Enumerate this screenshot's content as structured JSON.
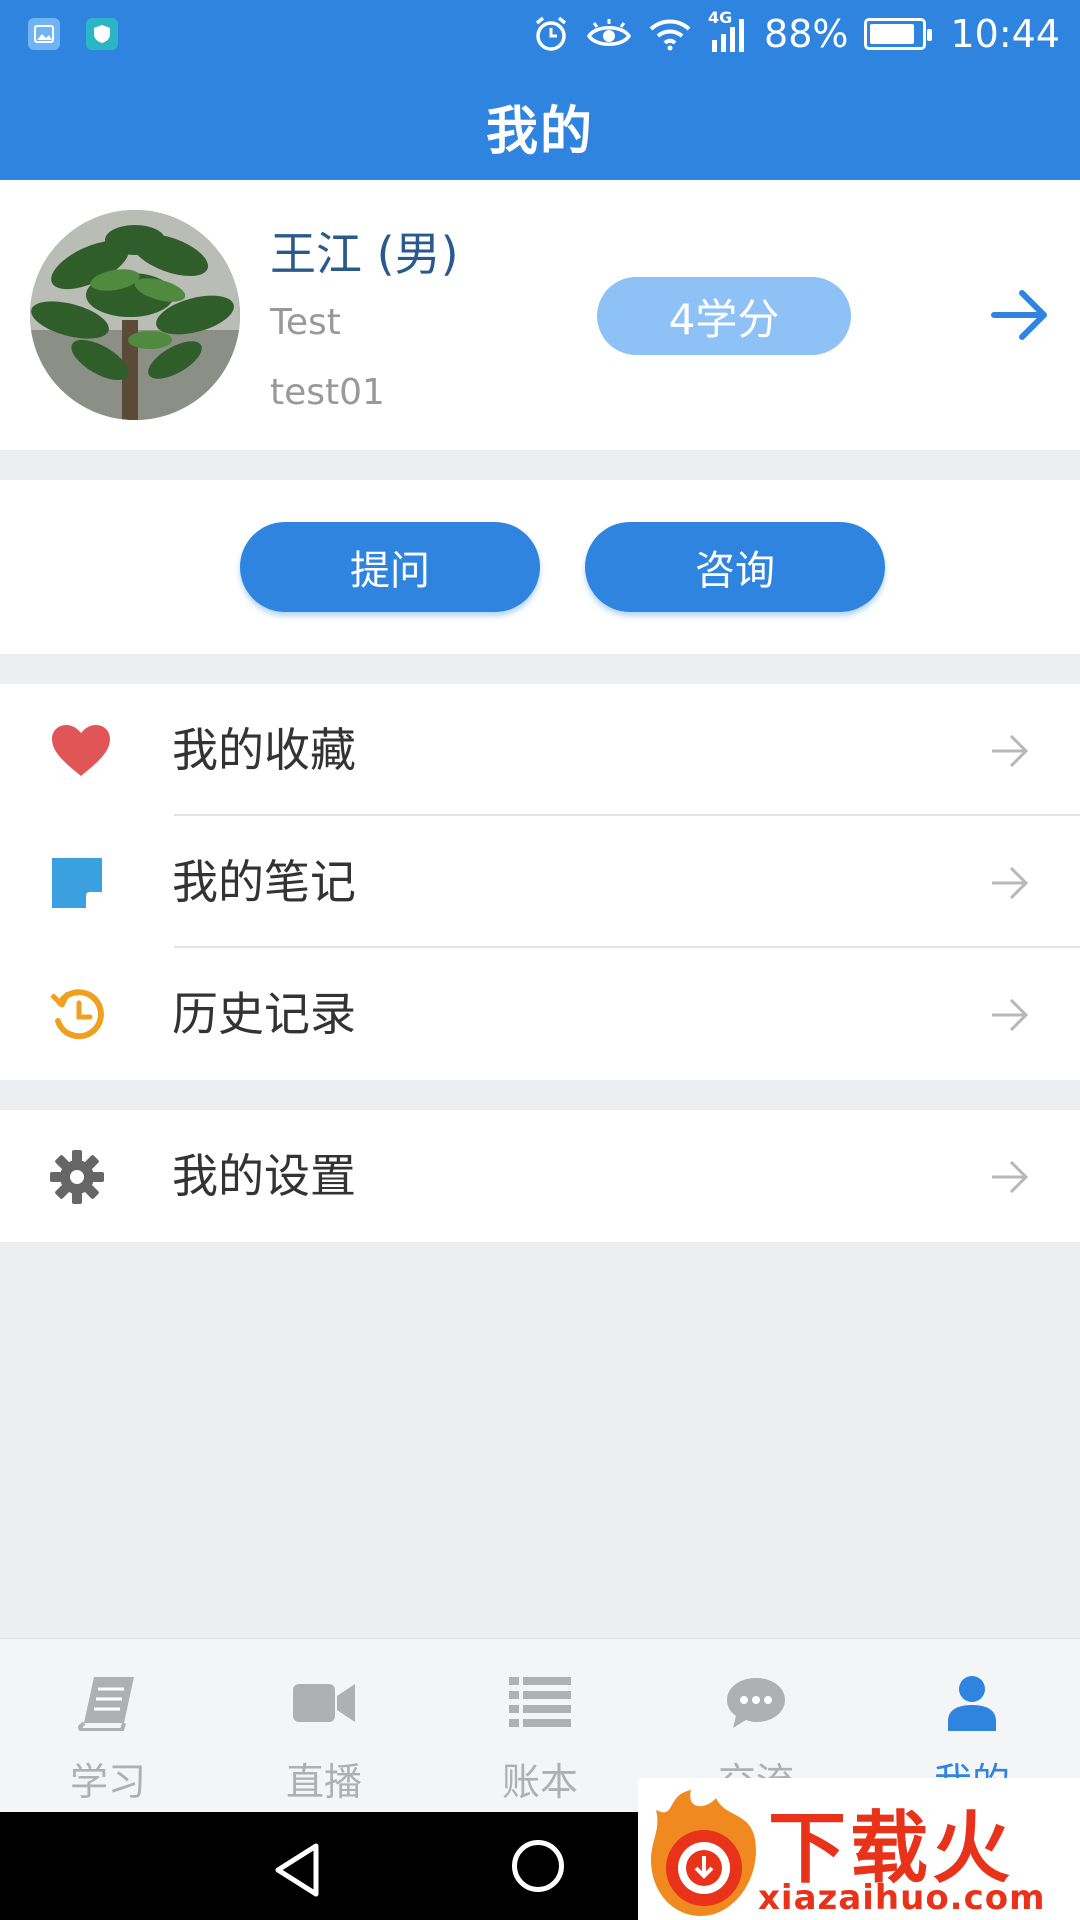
{
  "status_bar": {
    "battery": "88%",
    "network": "4G",
    "time": "10:44",
    "battery_level": 0.88
  },
  "header": {
    "title": "我的"
  },
  "profile": {
    "name": "王江 (男)",
    "nickname": "Test",
    "username": "test01",
    "credits": "4学分"
  },
  "actions": {
    "ask_label": "提问",
    "consult_label": "咨询"
  },
  "menu": {
    "favorites": "我的收藏",
    "notes": "我的笔记",
    "history": "历史记录",
    "settings": "我的设置"
  },
  "tabs": [
    {
      "label": "学习",
      "icon": "book-icon"
    },
    {
      "label": "直播",
      "icon": "video-camera-icon"
    },
    {
      "label": "账本",
      "icon": "list-icon"
    },
    {
      "label": "交流",
      "icon": "chat-bubble-icon"
    },
    {
      "label": "我的",
      "icon": "user-icon",
      "active": true
    }
  ],
  "watermark": {
    "brand": "下载火",
    "url": "xiazaihuo.com"
  },
  "colors": {
    "primary": "#2f84e0",
    "credit_pill": "#8ec1f5",
    "favorite_heart": "#e05555",
    "note": "#3aa0e0",
    "history": "#f0a020",
    "settings_gear": "#666666",
    "tab_inactive": "#aeb0b3",
    "page_bg": "#eceef1"
  }
}
